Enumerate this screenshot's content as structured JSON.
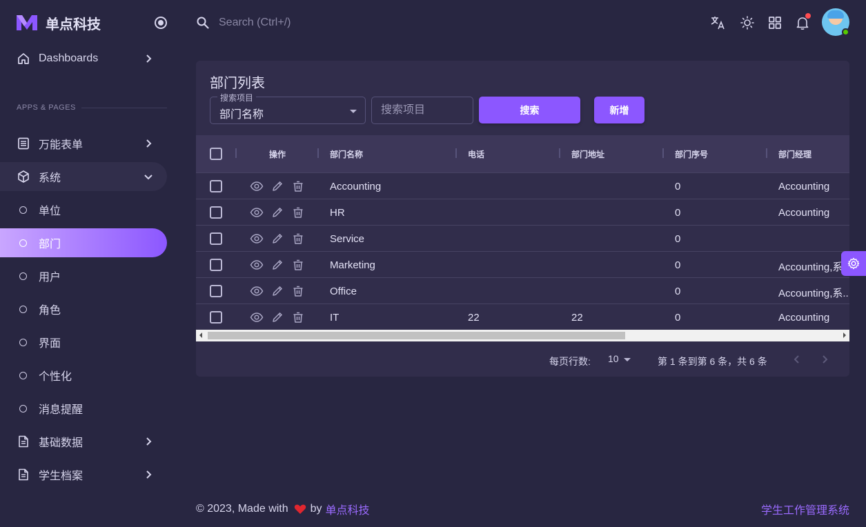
{
  "brand": {
    "name": "单点科技",
    "logo_color": "#8c57ff"
  },
  "topbar": {
    "search_placeholder": "Search (Ctrl+/)"
  },
  "sidebar": {
    "dashboards": "Dashboards",
    "section_title": "APPS & PAGES",
    "items": [
      {
        "label": "万能表单"
      },
      {
        "label": "系统"
      },
      {
        "label": "基础数据"
      },
      {
        "label": "学生档案"
      }
    ],
    "sub_items": [
      {
        "label": "单位"
      },
      {
        "label": "部门"
      },
      {
        "label": "用户"
      },
      {
        "label": "角色"
      },
      {
        "label": "界面"
      },
      {
        "label": "个性化"
      },
      {
        "label": "消息提醒"
      }
    ]
  },
  "card": {
    "title": "部门列表",
    "filter": {
      "legend": "搜索项目",
      "selected": "部门名称",
      "input_placeholder": "搜索项目"
    },
    "buttons": {
      "search": "搜索",
      "add": "新增"
    }
  },
  "table": {
    "columns": [
      "操作",
      "部门名称",
      "电话",
      "部门地址",
      "部门序号",
      "部门经理"
    ],
    "rows": [
      {
        "name": "Accounting",
        "phone": "",
        "address": "",
        "order": "0",
        "manager": "Accounting"
      },
      {
        "name": "HR",
        "phone": "",
        "address": "",
        "order": "0",
        "manager": "Accounting"
      },
      {
        "name": "Service",
        "phone": "",
        "address": "",
        "order": "0",
        "manager": ""
      },
      {
        "name": "Marketing",
        "phone": "",
        "address": "",
        "order": "0",
        "manager": "Accounting,系"
      },
      {
        "name": "Office",
        "phone": "",
        "address": "",
        "order": "0",
        "manager": "Accounting,系.."
      },
      {
        "name": "IT",
        "phone": "22",
        "address": "22",
        "order": "0",
        "manager": "Accounting"
      }
    ]
  },
  "pager": {
    "rows_per_page_label": "每页行数:",
    "rows_per_page": "10",
    "range": "第 1 条到第 6 条，共 6 条"
  },
  "footer": {
    "left_text": "© 2023, Made with",
    "by": "by",
    "brand": "单点科技",
    "right_text": "学生工作管理系统"
  },
  "colors": {
    "background": "#282641",
    "card": "#312d4b",
    "primary": "#8c57ff",
    "danger": "#ff4c51",
    "online": "#56ca00"
  },
  "icons": [
    "menu-logo-icon",
    "radio-toggle-icon",
    "home-icon",
    "chevron-right-icon",
    "chevron-down-icon",
    "form-icon",
    "cube-icon",
    "document-icon",
    "search-icon",
    "translate-icon",
    "sun-icon",
    "grid-icon",
    "bell-icon",
    "eye-icon",
    "pencil-icon",
    "trash-icon",
    "gear-icon",
    "heart-icon"
  ]
}
